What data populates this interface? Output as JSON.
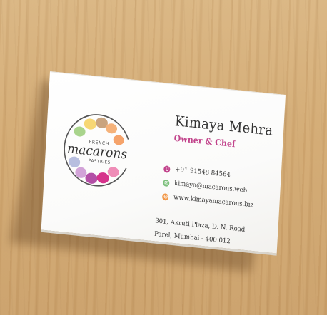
{
  "card": {
    "name": "Kimaya Mehra",
    "role": "Owner & Chef",
    "phone": "+91 91548 84564",
    "email": "kimaya@macarons.web",
    "website": "www.kimayamacarons.biz",
    "address_line1": "301, Akruti Plaza, D. N. Road",
    "address_line2": "Parel, Mumbai - 400 012"
  },
  "logo": {
    "top_text": "FRENCH",
    "main_text": "macarons",
    "bottom_text": "PASTRIES"
  },
  "icons": {
    "phone": "phone-icon",
    "email": "mail-icon",
    "website": "globe-icon"
  },
  "colors": {
    "accent": "#c2448c",
    "phone_icon": "#c2448c",
    "email_icon": "#7dc07d",
    "web_icon": "#f2994a",
    "text": "#333333"
  }
}
